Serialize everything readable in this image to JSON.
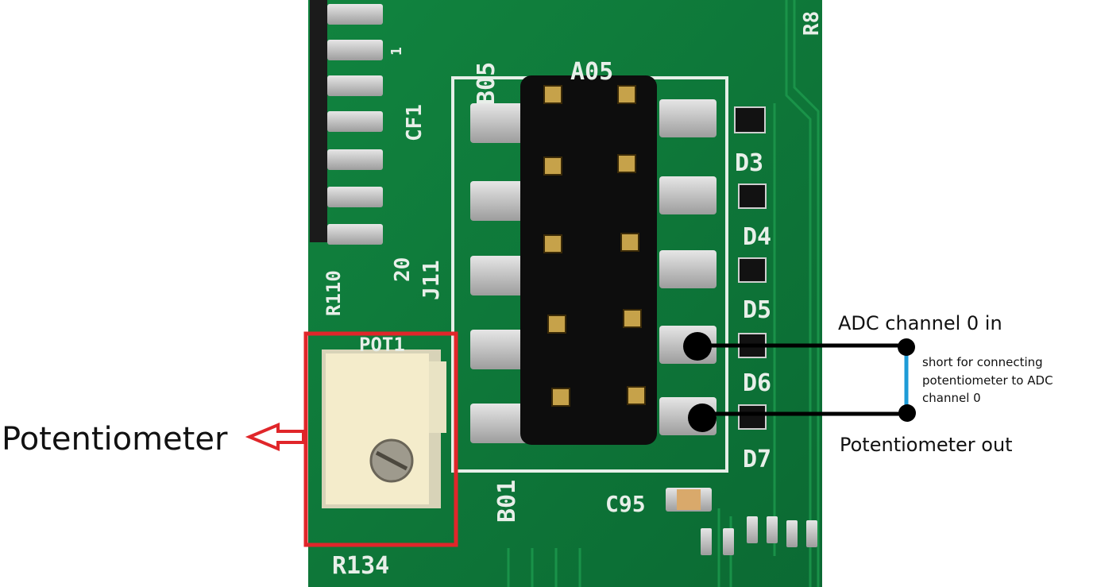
{
  "annotations": {
    "potentiometer": "Potentiometer",
    "adc_in": "ADC channel 0 in",
    "pot_out": "Potentiometer out",
    "short_note_lines": [
      "short for connecting",
      "potentiometer to ADC",
      "channel 0"
    ]
  },
  "board_silkscreen": {
    "b05": "B05",
    "a05": "A05",
    "b01": "B01",
    "cf1": "CF1",
    "j11": "J11",
    "n20": "20",
    "n1": "1",
    "r110": "R110",
    "pot1": "POT1",
    "r134": "R134",
    "c95": "C95",
    "d3": "D3",
    "d4": "D4",
    "d5": "D5",
    "d6": "D6",
    "d7": "D7",
    "r8": "R8"
  },
  "colors": {
    "pcb": "#0f7a3a",
    "highlight_box": "#e0262a",
    "wire": "#000000",
    "short_link": "#1e9bd7"
  }
}
